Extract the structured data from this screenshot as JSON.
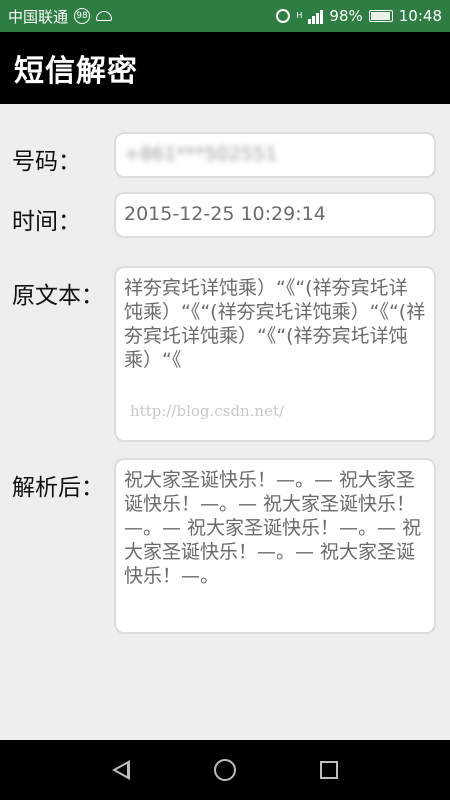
{
  "status_bar": {
    "carrier": "中国联通",
    "carrier_badge": "98",
    "network_type": "H",
    "battery_percent": "98%",
    "time": "10:48",
    "icons": [
      "android-icon",
      "alarm-icon",
      "signal-icon",
      "battery-icon"
    ]
  },
  "app_bar": {
    "title": "短信解密"
  },
  "form": {
    "phone": {
      "label": "号码：",
      "value": "+861***502551"
    },
    "time": {
      "label": "时间：",
      "value": "2015-12-25 10:29:14"
    },
    "original": {
      "label": "原文本：",
      "value": "祥夯宾圫详饨乘）“《“(祥夯宾圫详饨乘）“《“(祥夯宾圫详饨乘）“《“(祥夯宾圫详饨乘）“《“(祥夯宾圫详饨乘）“《"
    },
    "parsed": {
      "label": "解析后：",
      "value": "祝大家圣诞快乐！—。— 祝大家圣诞快乐！—。— 祝大家圣诞快乐！—。— 祝大家圣诞快乐！—。— 祝大家圣诞快乐！—。— 祝大家圣诞快乐！—。"
    }
  },
  "watermark": "http://blog.csdn.net/",
  "nav_bar": {
    "icons": [
      "back-icon",
      "home-icon",
      "recent-apps-icon"
    ]
  },
  "colors": {
    "status_bar": "#2e7d42",
    "app_bar": "#000000",
    "background": "#eeeeee",
    "field_text": "#6b6b6b"
  }
}
